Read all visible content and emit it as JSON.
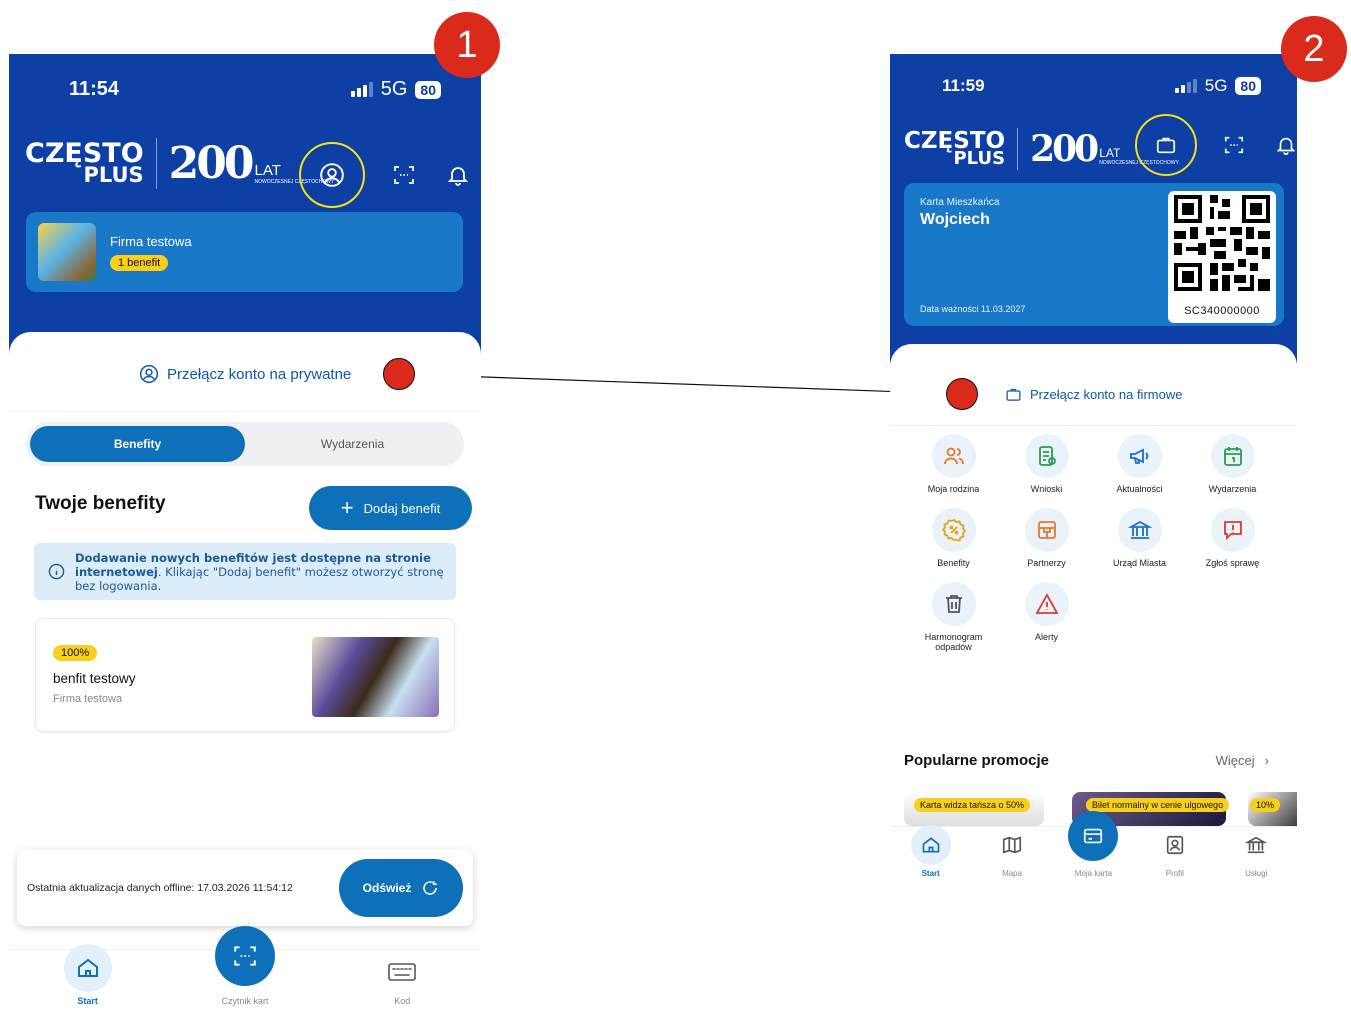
{
  "annotations": {
    "step1": "1",
    "step2": "2"
  },
  "screen1": {
    "status": {
      "time": "11:54",
      "network": "5G",
      "battery": "80"
    },
    "logo": {
      "line1": "CZĘSTO",
      "line2": "PLUS",
      "anniversary_number": "200",
      "anniversary_lat": "LAT",
      "anniversary_sub": "NOWOCZESNEJ CZĘSTOCHOWY"
    },
    "header_icons": [
      "user-circle-icon",
      "scan-icon",
      "bell-icon"
    ],
    "firm_card": {
      "name": "Firma testowa",
      "badge": "1 benefit"
    },
    "switch_label": "Przełącz konto na prywatne",
    "tabs": [
      {
        "label": "Benefity",
        "active": true
      },
      {
        "label": "Wydarzenia",
        "active": false
      }
    ],
    "benefits_title": "Twoje benefity",
    "add_button": "Dodaj benefit",
    "info": {
      "bold1": "Dodawanie nowych benefitów jest dostępne na stronie",
      "bold2": "internetowej",
      "rest": ". Klikając \"Dodaj benefit\" możesz otworzyć stronę bez logowania."
    },
    "benefit": {
      "percent": "100%",
      "name": "benfit testowy",
      "firm": "Firma testowa"
    },
    "offline": {
      "text": "Ostatnia aktualizacja danych offline: 17.03.2026 11:54:12",
      "button": "Odśwież"
    },
    "nav": [
      {
        "label": "Start",
        "icon": "home-icon",
        "active": true
      },
      {
        "label": "Czytnik kart",
        "icon": "scan-icon",
        "active": false
      },
      {
        "label": "Kod",
        "icon": "keyboard-icon",
        "active": false
      }
    ]
  },
  "screen2": {
    "status": {
      "time": "11:59",
      "network": "5G",
      "battery": "80"
    },
    "logo": {
      "line1": "CZĘSTO",
      "line2": "PLUS",
      "anniversary_number": "200",
      "anniversary_lat": "LAT",
      "anniversary_sub": "NOWOCZESNEJ CZĘSTOCHOWY"
    },
    "header_icons": [
      "briefcase-icon",
      "scan-icon",
      "bell-icon"
    ],
    "resident_card": {
      "label": "Karta Mieszkańca",
      "name": "Wojciech",
      "expiry": "Data ważności 11.03.2027",
      "code": "SC340000000"
    },
    "switch_label": "Przełącz konto na firmowe",
    "tiles": [
      {
        "label": "Moja rodzina",
        "icon": "family-icon"
      },
      {
        "label": "Wnioski",
        "icon": "document-icon"
      },
      {
        "label": "Aktualności",
        "icon": "megaphone-icon"
      },
      {
        "label": "Wydarzenia",
        "icon": "calendar-icon"
      },
      {
        "label": "Benefity",
        "icon": "discount-icon"
      },
      {
        "label": "Partnerzy",
        "icon": "store-icon"
      },
      {
        "label": "Urząd Miasta",
        "icon": "city-hall-icon"
      },
      {
        "label": "Zgłoś sprawę",
        "icon": "report-icon"
      },
      {
        "label": "Harmonogram odpadów",
        "icon": "trash-icon"
      },
      {
        "label": "Alerty",
        "icon": "alert-icon"
      }
    ],
    "promos_title": "Popularne promocje",
    "promos_more": "Więcej",
    "promos": [
      {
        "tag": "Karta widza tańsza o 50%"
      },
      {
        "tag": "Bilet normalny w cenie ulgowego"
      },
      {
        "tag": "10%"
      }
    ],
    "nav": [
      {
        "label": "Start",
        "icon": "home-icon",
        "active": true
      },
      {
        "label": "Mapa",
        "icon": "map-icon",
        "active": false
      },
      {
        "label": "Moja karta",
        "icon": "card-icon",
        "active": false
      },
      {
        "label": "Profil",
        "icon": "profile-icon",
        "active": false
      },
      {
        "label": "Usługi",
        "icon": "services-icon",
        "active": false
      }
    ]
  },
  "colors": {
    "brand_blue": "#0d3fa5",
    "card_blue": "#1a78c8",
    "accent_blue": "#0e70b8",
    "badge_yellow": "#f9cf1a",
    "highlight_ring": "#f4e11a",
    "annotation_red": "#d92a1c"
  }
}
